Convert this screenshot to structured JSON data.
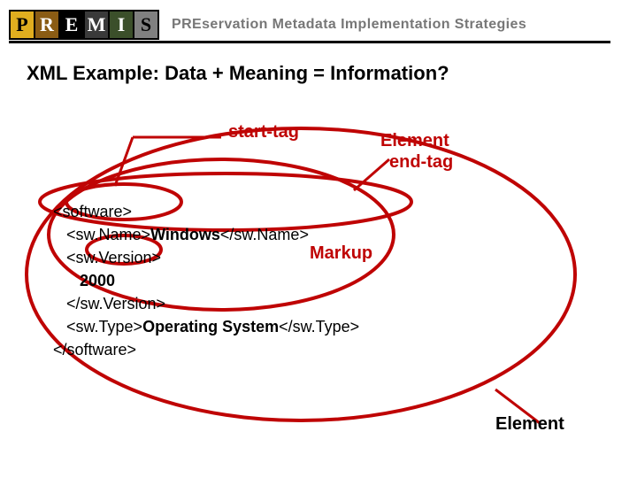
{
  "header": {
    "logo_letters": [
      "P",
      "R",
      "E",
      "M",
      "I",
      "S"
    ],
    "tagline": "PREservation Metadata Implementation Strategies"
  },
  "title": "XML Example: Data + Meaning = Information?",
  "annotations": {
    "start_tag": "start-tag",
    "element_top": "Element",
    "end_tag": "end-tag",
    "markup": "Markup",
    "element_bottom": "Element"
  },
  "xml": {
    "l1": "<software>",
    "l2a": "   <sw.Name>",
    "l2b": "Windows",
    "l2c": "</sw.Name>",
    "l3": "   <sw.Version>",
    "l4": "      2000",
    "l5": "   </sw.Version>",
    "l6a": "   <sw.Type>",
    "l6b": "Operating System",
    "l6c": "</sw.Type>",
    "l7": "</software>"
  }
}
